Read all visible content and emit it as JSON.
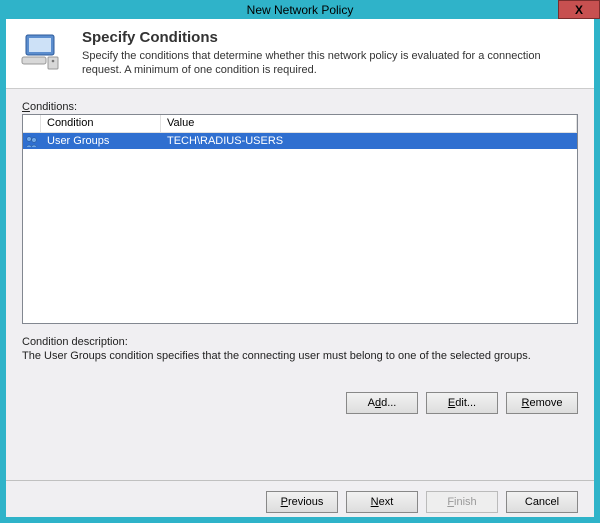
{
  "window": {
    "title": "New Network Policy",
    "close": "X"
  },
  "header": {
    "title": "Specify Conditions",
    "subtitle": "Specify the conditions that determine whether this network policy is evaluated for a connection request. A minimum of one condition is required."
  },
  "conditions": {
    "label_pre": "C",
    "label_rest": "onditions:",
    "columns": {
      "condition": "Condition",
      "value": "Value"
    },
    "rows": [
      {
        "condition": "User Groups",
        "value": "TECH\\RADIUS-USERS",
        "selected": true
      }
    ]
  },
  "description": {
    "label": "Condition description:",
    "text": "The User Groups condition specifies that the connecting user must belong to one of the selected groups."
  },
  "actions": {
    "add_u": "d",
    "add_pre": "A",
    "add_post": "d...",
    "edit_u": "E",
    "edit_rest": "dit...",
    "remove_u": "R",
    "remove_rest": "emove"
  },
  "footer": {
    "previous_u": "P",
    "previous_rest": "revious",
    "next_u": "N",
    "next_rest": "ext",
    "finish_u": "F",
    "finish_rest": "inish",
    "cancel": "Cancel"
  }
}
